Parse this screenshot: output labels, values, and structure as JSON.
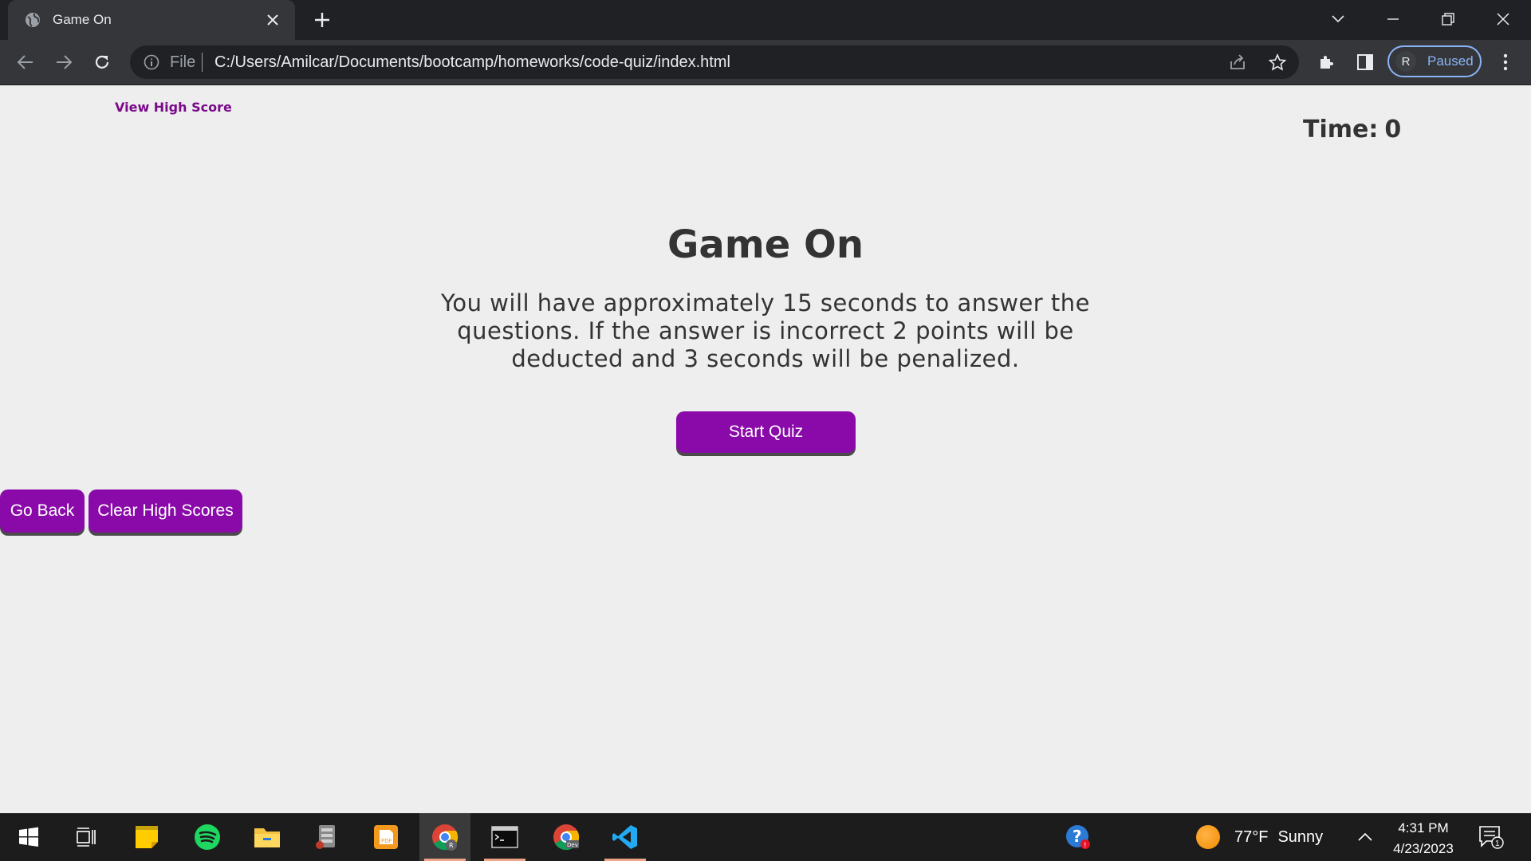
{
  "browser": {
    "tab_title": "Game On",
    "url_scheme": "File",
    "url": "C:/Users/Amilcar/Documents/bootcamp/homeworks/code-quiz/index.html",
    "profile_initial": "R",
    "profile_status": "Paused"
  },
  "page": {
    "high_score_link": "View High Score",
    "timer_label": "Time:",
    "timer_value": "0",
    "heading": "Game On",
    "instructions": "You will have approximately 15 seconds to answer the questions. If the answer is incorrect 2 points will be deducted and 3 seconds will be penalized.",
    "start_button": "Start Quiz",
    "go_back_button": "Go Back",
    "clear_button": "Clear High Scores",
    "accent_color": "#8a0aa9",
    "link_color": "#7a0a8a"
  },
  "taskbar": {
    "apps": [
      "start",
      "task-view",
      "sticky-notes",
      "spotify",
      "file-explorer",
      "media-app",
      "pdf-app",
      "chrome",
      "terminal",
      "chrome-dev",
      "vscode"
    ],
    "weather_temp": "77°F",
    "weather_condition": "Sunny",
    "time": "4:31 PM",
    "date": "4/23/2023",
    "notification_count": "1"
  }
}
